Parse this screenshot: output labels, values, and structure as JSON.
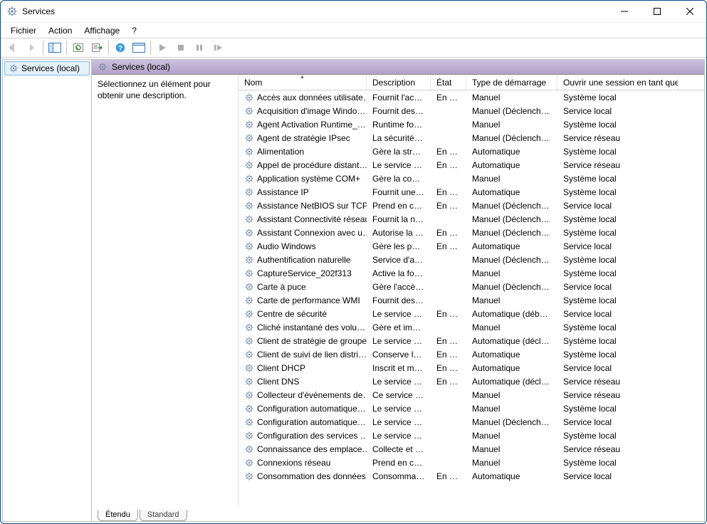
{
  "window": {
    "title": "Services"
  },
  "menu": {
    "fichier": "Fichier",
    "action": "Action",
    "affichage": "Affichage",
    "help": "?"
  },
  "toolbar_icons": {
    "back": "back-arrow-icon",
    "forward": "forward-arrow-icon",
    "show_hide_tree": "tree-pane-icon",
    "refresh": "refresh-icon",
    "export": "export-list-icon",
    "help": "help-icon",
    "props": "properties-sheet-icon",
    "start": "start-icon",
    "stop": "stop-icon",
    "pause": "pause-icon",
    "restart": "restart-icon"
  },
  "tree": {
    "root": "Services (local)"
  },
  "pane_header": "Services (local)",
  "desc_panel": "Sélectionnez un élément pour obtenir une description.",
  "columns": {
    "nom": "Nom",
    "description": "Description",
    "etat": "État",
    "demarrage": "Type de démarrage",
    "session": "Ouvrir une session en tant que"
  },
  "sort_column": "nom",
  "tabs": {
    "etendu": "Étendu",
    "standard": "Standard"
  },
  "services": [
    {
      "nom": "Accès aux données utilisate…",
      "desc": "Fournit l'ac…",
      "etat": "En co…",
      "dem": "Manuel",
      "logon": "Système local"
    },
    {
      "nom": "Acquisition d'image Windo…",
      "desc": "Fournit des …",
      "etat": "",
      "dem": "Manuel (Déclenche…",
      "logon": "Service local"
    },
    {
      "nom": "Agent Activation Runtime_…",
      "desc": "Runtime for…",
      "etat": "",
      "dem": "Manuel",
      "logon": "Système local"
    },
    {
      "nom": "Agent de stratégie IPsec",
      "desc": "La sécurité …",
      "etat": "",
      "dem": "Manuel (Déclenche…",
      "logon": "Service réseau"
    },
    {
      "nom": "Alimentation",
      "desc": "Gère la strat…",
      "etat": "En co…",
      "dem": "Automatique",
      "logon": "Système local"
    },
    {
      "nom": "Appel de procédure distant…",
      "desc": "Le service R…",
      "etat": "En co…",
      "dem": "Automatique",
      "logon": "Service réseau"
    },
    {
      "nom": "Application système COM+",
      "desc": "Gère la conf…",
      "etat": "",
      "dem": "Manuel",
      "logon": "Système local"
    },
    {
      "nom": "Assistance IP",
      "desc": "Fournit une …",
      "etat": "En co…",
      "dem": "Automatique",
      "logon": "Système local"
    },
    {
      "nom": "Assistance NetBIOS sur TCP…",
      "desc": "Prend en ch…",
      "etat": "En co…",
      "dem": "Manuel (Déclenche…",
      "logon": "Service local"
    },
    {
      "nom": "Assistant Connectivité réseau",
      "desc": "Fournit la n…",
      "etat": "",
      "dem": "Manuel (Déclenche…",
      "logon": "Système local"
    },
    {
      "nom": "Assistant Connexion avec u…",
      "desc": "Autorise la …",
      "etat": "En co…",
      "dem": "Manuel (Déclenche…",
      "logon": "Système local"
    },
    {
      "nom": "Audio Windows",
      "desc": "Gère les péri…",
      "etat": "En co…",
      "dem": "Automatique",
      "logon": "Service local"
    },
    {
      "nom": "Authentification naturelle",
      "desc": "Service d'ag…",
      "etat": "",
      "dem": "Manuel (Déclenche…",
      "logon": "Système local"
    },
    {
      "nom": "CaptureService_202f313",
      "desc": "Active la fo…",
      "etat": "",
      "dem": "Manuel",
      "logon": "Système local"
    },
    {
      "nom": "Carte à puce",
      "desc": "Gère l'accès…",
      "etat": "",
      "dem": "Manuel (Déclenche…",
      "logon": "Service local"
    },
    {
      "nom": "Carte de performance WMI",
      "desc": "Fournit des …",
      "etat": "",
      "dem": "Manuel",
      "logon": "Système local"
    },
    {
      "nom": "Centre de sécurité",
      "desc": "Le service …",
      "etat": "En co…",
      "dem": "Automatique (débu…",
      "logon": "Service local"
    },
    {
      "nom": "Cliché instantané des volu…",
      "desc": "Gère et impl…",
      "etat": "",
      "dem": "Manuel",
      "logon": "Système local"
    },
    {
      "nom": "Client de stratégie de groupe",
      "desc": "Le service e…",
      "etat": "En co…",
      "dem": "Automatique (décle…",
      "logon": "Système local"
    },
    {
      "nom": "Client de suivi de lien distri…",
      "desc": "Conserve le…",
      "etat": "En co…",
      "dem": "Automatique",
      "logon": "Système local"
    },
    {
      "nom": "Client DHCP",
      "desc": "Inscrit et m…",
      "etat": "En co…",
      "dem": "Automatique",
      "logon": "Service local"
    },
    {
      "nom": "Client DNS",
      "desc": "Le service cl…",
      "etat": "En co…",
      "dem": "Automatique (décle…",
      "logon": "Service réseau"
    },
    {
      "nom": "Collecteur d'événements de…",
      "desc": "Ce service g…",
      "etat": "",
      "dem": "Manuel",
      "logon": "Service réseau"
    },
    {
      "nom": "Configuration automatique…",
      "desc": "Le service …",
      "etat": "",
      "dem": "Manuel",
      "logon": "Système local"
    },
    {
      "nom": "Configuration automatique…",
      "desc": "Le service C…",
      "etat": "",
      "dem": "Manuel (Déclenche…",
      "logon": "Service local"
    },
    {
      "nom": "Configuration des services …",
      "desc": "Le service C…",
      "etat": "",
      "dem": "Manuel",
      "logon": "Système local"
    },
    {
      "nom": "Connaissance des emplace…",
      "desc": "Collecte et s…",
      "etat": "",
      "dem": "Manuel",
      "logon": "Service réseau"
    },
    {
      "nom": "Connexions réseau",
      "desc": "Prend en ch…",
      "etat": "",
      "dem": "Manuel",
      "logon": "Système local"
    },
    {
      "nom": "Consommation des données",
      "desc": "Consomma…",
      "etat": "En co…",
      "dem": "Automatique",
      "logon": "Service local"
    }
  ]
}
